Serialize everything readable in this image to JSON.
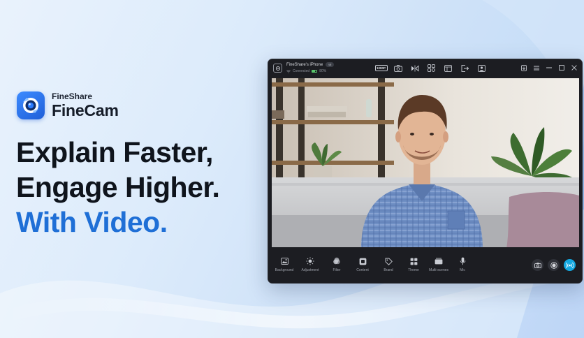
{
  "brand": {
    "small": "FineShare",
    "name": "FineCam",
    "logo_icon": "camera-lens-icon"
  },
  "headline": {
    "line1": "Explain Faster,",
    "line2": "Engage Higher.",
    "line3": "With Video."
  },
  "colors": {
    "accent": "#1f6fd6",
    "window_bg": "#1c1d22",
    "live": "#14a8e0",
    "battery": "#59c46b"
  },
  "window": {
    "device_name": "FineShare's iPhone",
    "device_badge": "wi",
    "status": "Connected",
    "battery": "80%",
    "resolution": "1080P",
    "title_tools": [
      "resolution-chip",
      "camera-icon",
      "flip-icon",
      "layout-icon",
      "window-icon",
      "share-icon",
      "portrait-icon"
    ],
    "window_controls": [
      "pin-icon",
      "menu-icon",
      "minimize-icon",
      "maximize-icon",
      "close-icon"
    ],
    "bottom_tools": [
      {
        "label": "Background",
        "icon": "image-icon"
      },
      {
        "label": "Adjustment",
        "icon": "brightness-icon"
      },
      {
        "label": "Filter",
        "icon": "filter-icon"
      },
      {
        "label": "Content",
        "icon": "content-icon"
      },
      {
        "label": "Brand",
        "icon": "tag-icon"
      },
      {
        "label": "Theme",
        "icon": "grid-icon"
      },
      {
        "label": "Multi-scenes",
        "icon": "scenes-icon"
      },
      {
        "label": "Mic",
        "icon": "mic-icon"
      }
    ],
    "record_controls": [
      "snapshot-icon",
      "record-icon",
      "live-icon"
    ]
  }
}
